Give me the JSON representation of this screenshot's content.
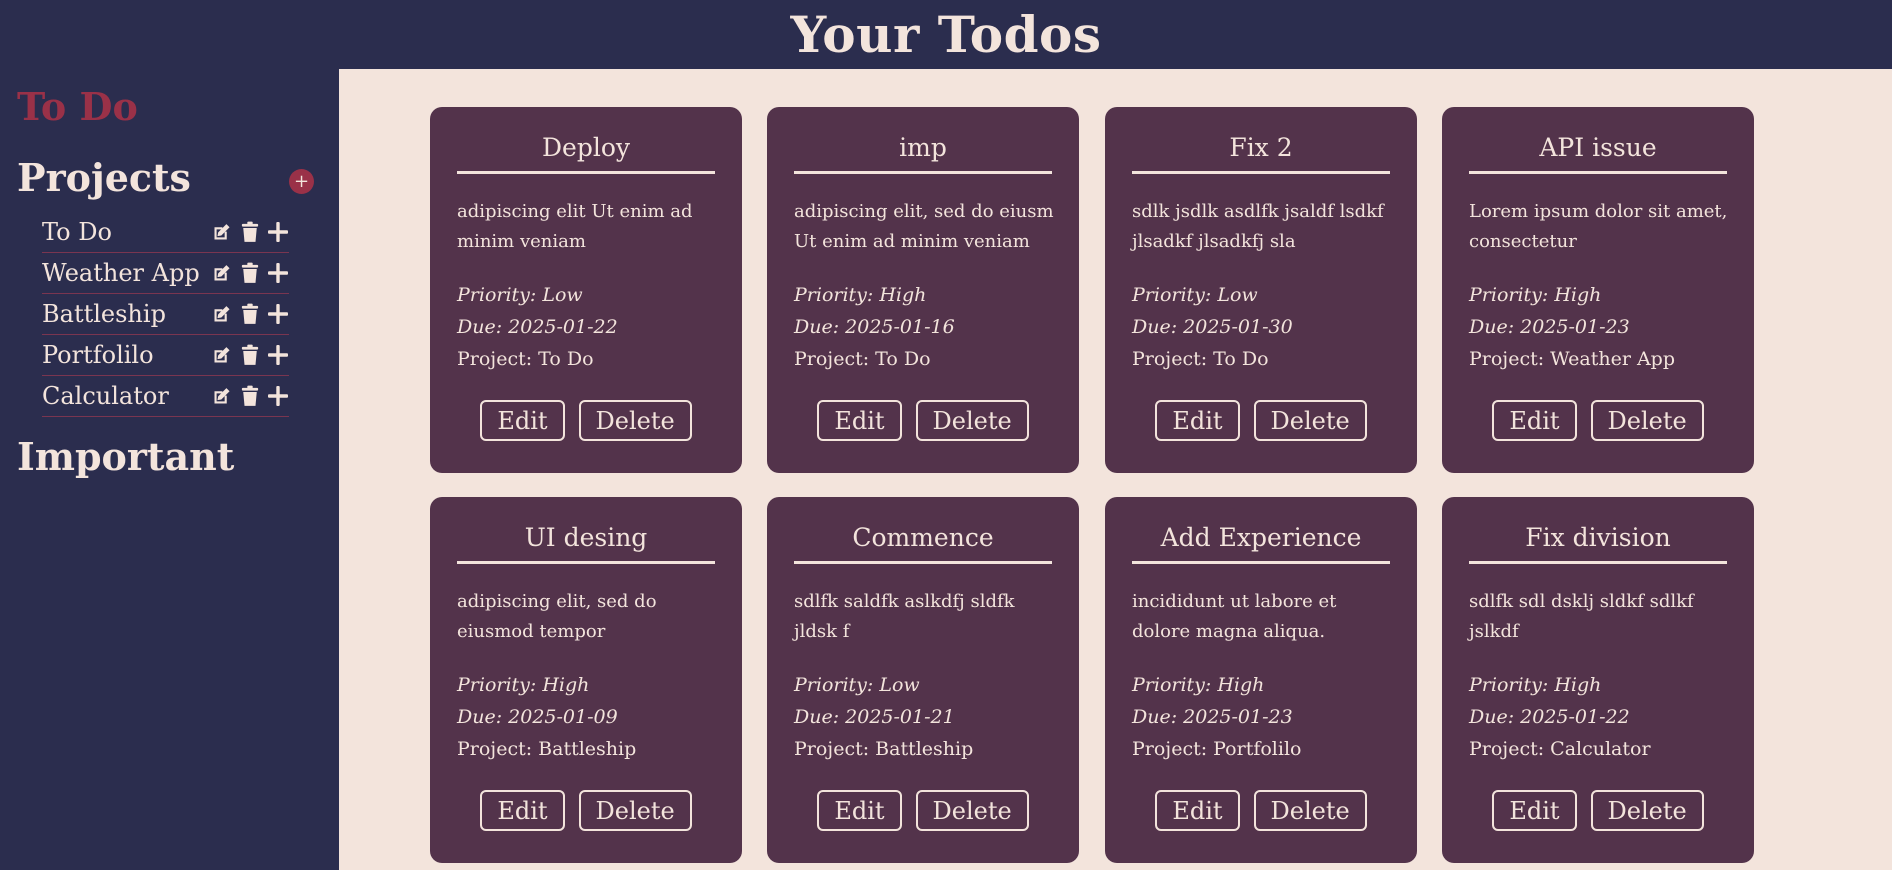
{
  "header": {
    "title": "Your Todos"
  },
  "sidebar": {
    "brand": "To Do",
    "projects_heading": "Projects",
    "add_project_symbol": "+",
    "projects": [
      {
        "name": "To Do"
      },
      {
        "name": "Weather App"
      },
      {
        "name": "Battleship"
      },
      {
        "name": "Portfolilo"
      },
      {
        "name": "Calculator"
      }
    ],
    "important_heading": "Important"
  },
  "todos": [
    {
      "title": "Deploy",
      "description": "adipiscing elit Ut enim ad minim veniam",
      "priority": "Priority: Low",
      "due": "Due: 2025-01-22",
      "project": "Project: To Do",
      "edit_label": "Edit",
      "delete_label": "Delete"
    },
    {
      "title": "imp",
      "description": "adipiscing elit, sed do eiusm Ut enim ad minim veniam",
      "priority": "Priority: High",
      "due": "Due: 2025-01-16",
      "project": "Project: To Do",
      "edit_label": "Edit",
      "delete_label": "Delete"
    },
    {
      "title": "Fix 2",
      "description": "sdlk jsdlk asdlfk jsaldf lsdkf jlsadkf jlsadkfj sla",
      "priority": "Priority: Low",
      "due": "Due: 2025-01-30",
      "project": "Project: To Do",
      "edit_label": "Edit",
      "delete_label": "Delete"
    },
    {
      "title": "API issue",
      "description": "Lorem ipsum dolor sit amet, consectetur",
      "priority": "Priority: High",
      "due": "Due: 2025-01-23",
      "project": "Project: Weather App",
      "edit_label": "Edit",
      "delete_label": "Delete"
    },
    {
      "title": "UI desing",
      "description": "adipiscing elit, sed do eiusmod tempor",
      "priority": "Priority: High",
      "due": "Due: 2025-01-09",
      "project": "Project: Battleship",
      "edit_label": "Edit",
      "delete_label": "Delete"
    },
    {
      "title": "Commence",
      "description": "sdlfk saldfk aslkdfj sldfk jldsk f",
      "priority": "Priority: Low",
      "due": "Due: 2025-01-21",
      "project": "Project: Battleship",
      "edit_label": "Edit",
      "delete_label": "Delete"
    },
    {
      "title": "Add Experience",
      "description": "incididunt ut labore et dolore magna aliqua.",
      "priority": "Priority: High",
      "due": "Due: 2025-01-23",
      "project": "Project: Portfolilo",
      "edit_label": "Edit",
      "delete_label": "Delete"
    },
    {
      "title": "Fix division",
      "description": "sdlfk sdl dsklj sldkf sdlkf jslkdf",
      "priority": "Priority: High",
      "due": "Due: 2025-01-22",
      "project": "Project: Calculator",
      "edit_label": "Edit",
      "delete_label": "Delete"
    }
  ],
  "icons": {
    "edit": "edit-icon",
    "delete": "trash-icon",
    "add": "plus-icon"
  },
  "colors": {
    "navy": "#2b2d4e",
    "card": "#53334b",
    "cream": "#f3e4dc",
    "accent": "#9a3148"
  }
}
